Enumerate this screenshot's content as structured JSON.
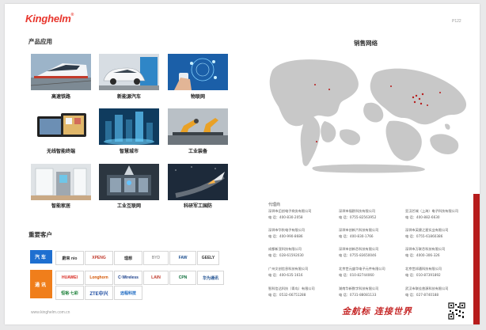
{
  "header": {
    "brand": "Kinghelm",
    "page_number": "P122"
  },
  "applications": {
    "title": "产品应用",
    "items": [
      {
        "label": "高速铁路",
        "icon": "high-speed-train"
      },
      {
        "label": "新能源汽车",
        "icon": "ev-car"
      },
      {
        "label": "物联网",
        "icon": "iot-hand"
      },
      {
        "label": "无线智能终端",
        "icon": "smart-terminal"
      },
      {
        "label": "智慧城市",
        "icon": "smart-city"
      },
      {
        "label": "工业装备",
        "icon": "industrial-robot"
      },
      {
        "label": "智能家居",
        "icon": "smart-home"
      },
      {
        "label": "工业互联网",
        "icon": "industrial-internet"
      },
      {
        "label": "科研军工国防",
        "icon": "rocket-launch"
      }
    ]
  },
  "customers": {
    "title": "重要客户",
    "auto_label": "汽车",
    "auto_brands": [
      "蔚来 nio",
      "XPENG",
      "理想",
      "BYD",
      "FAW",
      "GEELY"
    ],
    "telecom_label": "通讯",
    "telecom_brands": [
      "HUAWEI",
      "Longhorn",
      "C·Wireless",
      "LAIN",
      "CPN",
      "华为通讯",
      "恒裕·七彩",
      "ZTE中兴",
      "远程科技"
    ]
  },
  "network": {
    "title": "销售网络",
    "agents_title": "代理商",
    "phone_label": "电 话：",
    "agents": [
      {
        "name": "深圳市迈创电子商务有限公司",
        "phone": "400-830-2058"
      },
      {
        "name": "深圳市福欧科技有限公司",
        "phone": "0755-82563952"
      },
      {
        "name": "亚汉芯城（上海）电子科技有限公司",
        "phone": "400-882-6630"
      },
      {
        "name": "深圳市华秋电子有限公司",
        "phone": "400-990-8686"
      },
      {
        "name": "深圳市创新六科技有限公司",
        "phone": "400-830-1766"
      },
      {
        "name": "深圳市英捷之星实业有限公司",
        "phone": "0755-61860386"
      },
      {
        "name": "成都新亚科技有限公司",
        "phone": "028-61592030"
      },
      {
        "name": "深圳市创新芯科技有限公司",
        "phone": "0755-83650046"
      },
      {
        "name": "深圳市万联芯科技有限公司",
        "phone": "4000-306-326"
      },
      {
        "name": "广州文创信息科技有限公司",
        "phone": "400-635-1616"
      },
      {
        "name": "北京世元盛华电子元件有限公司",
        "phone": "010-82744060"
      },
      {
        "name": "北京世邦通科技有限公司",
        "phone": "010-87391892"
      },
      {
        "name": "智科信达科技（青岛）有限公司",
        "phone": "0532-66751288"
      },
      {
        "name": "湖南华新数字科技有限公司",
        "phone": "0731-88081133"
      },
      {
        "name": "武汉市联佳普源科技有限公司",
        "phone": "027-8740188"
      }
    ]
  },
  "footer": {
    "website": "www.kinghelm.com.cn",
    "slogan": "金航标 连接世界"
  },
  "colors": {
    "brand_red": "#e8352c",
    "auto_blue": "#1e6fd0",
    "telecom_orange": "#f07e1b",
    "map_gray": "#c8c8c8"
  }
}
